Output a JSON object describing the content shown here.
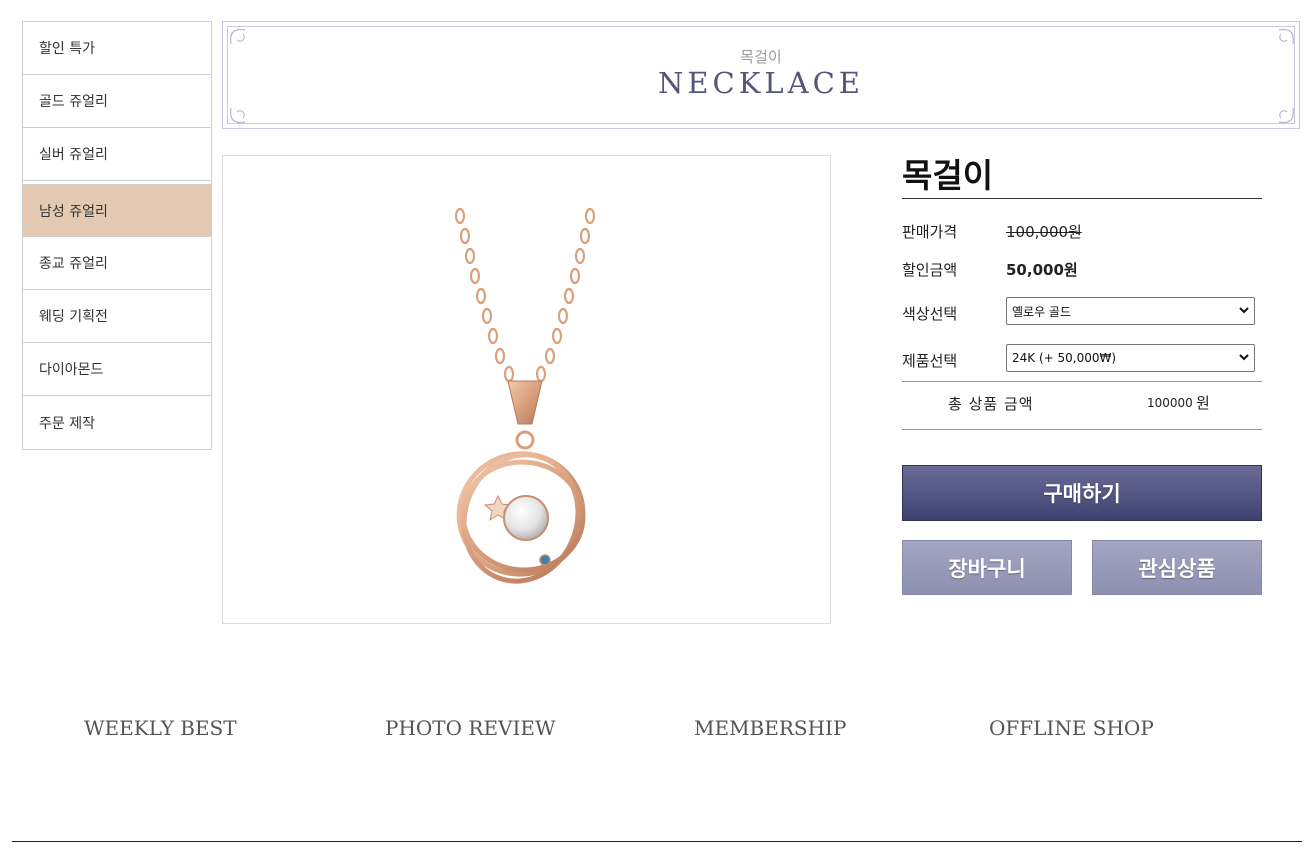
{
  "sidebar": {
    "items": [
      {
        "label": "할인 특가"
      },
      {
        "label": "골드 쥬얼리"
      },
      {
        "label": "실버 쥬얼리"
      },
      {
        "label": "남성 쥬얼리",
        "active": true
      },
      {
        "label": "종교 쥬얼리"
      },
      {
        "label": "웨딩 기획전"
      },
      {
        "label": "다이아몬드"
      },
      {
        "label": "주문 제작"
      }
    ],
    "active_color": "#e3c9b1"
  },
  "banner": {
    "subtitle": "목걸이",
    "title": "NECKLACE"
  },
  "product": {
    "image_icon": "necklace-image",
    "name": "목걸이",
    "price_label": "판매가격",
    "price_value": "100,000원",
    "discount_label": "할인금액",
    "discount_value": "50,000원",
    "color_label": "색상선택",
    "color_selected": "옐로우 골드",
    "option_label": "제품선택",
    "option_selected": "24K (+ 50,000₩)",
    "total_label": "총 상품 금액",
    "total_amount": "100000",
    "total_unit": "원"
  },
  "buttons": {
    "buy": "구매하기",
    "cart": "장바구니",
    "wish": "관심상품"
  },
  "bottom_links": [
    "WEEKLY BEST",
    "PHOTO REVIEW",
    "MEMBERSHIP",
    "OFFLINE SHOP"
  ],
  "colors": {
    "buy_button": "#4f5180",
    "secondary_button": "#9a9cbb",
    "banner_title": "#55557a",
    "necklace_gold": "#d9a07e"
  }
}
